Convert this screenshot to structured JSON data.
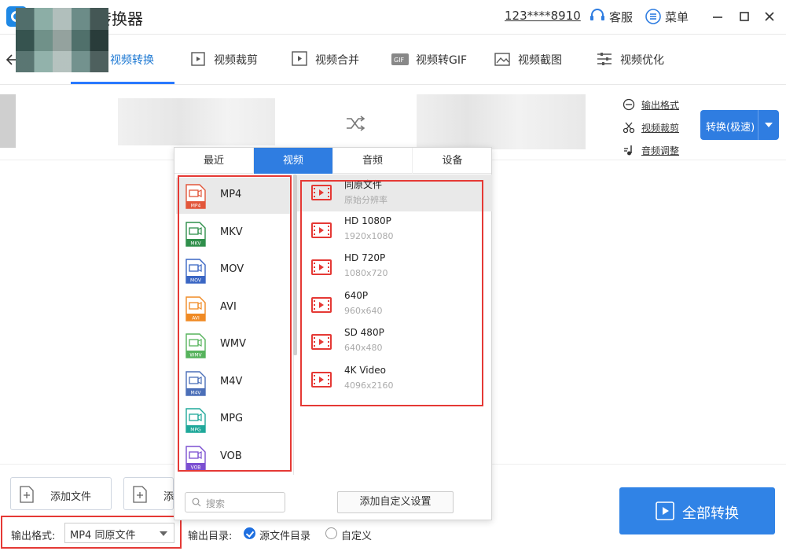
{
  "app": {
    "title": "风云视频转换器"
  },
  "account": {
    "phone": "123****8910",
    "service_label": "客服",
    "menu_label": "菜单"
  },
  "nav": {
    "back_label": "返回",
    "tabs": [
      {
        "label": "视频转换",
        "active": true
      },
      {
        "label": "视频裁剪"
      },
      {
        "label": "视频合并"
      },
      {
        "label": "视频转GIF"
      },
      {
        "label": "视频截图"
      },
      {
        "label": "视频优化"
      }
    ]
  },
  "file_options": {
    "output_format": "输出格式",
    "video_crop": "视频裁剪",
    "audio_adjust": "音频调整"
  },
  "convert_button": {
    "label": "转换(极速)"
  },
  "format_panel": {
    "tabs": [
      "最近",
      "视频",
      "音频",
      "设备"
    ],
    "active_tab": "视频",
    "formats": [
      {
        "name": "MP4",
        "badge": "MP4",
        "color": "#e2563a",
        "selected": true
      },
      {
        "name": "MKV",
        "badge": "MKV",
        "color": "#2f8f4b"
      },
      {
        "name": "MOV",
        "badge": "MOV",
        "color": "#3a66c4"
      },
      {
        "name": "AVI",
        "badge": "AVI",
        "color": "#f08a24"
      },
      {
        "name": "WMV",
        "badge": "WMV",
        "color": "#56b35c"
      },
      {
        "name": "M4V",
        "badge": "M4V",
        "color": "#4b6fb8"
      },
      {
        "name": "MPG",
        "badge": "MPG",
        "color": "#1fa89a"
      },
      {
        "name": "VOB",
        "badge": "VOB",
        "color": "#7b4fd1"
      }
    ],
    "resolutions": [
      {
        "name": "同原文件",
        "sub": "原始分辨率",
        "selected": true
      },
      {
        "name": "HD 1080P",
        "sub": "1920x1080"
      },
      {
        "name": "HD 720P",
        "sub": "1080x720"
      },
      {
        "name": "640P",
        "sub": "960x640"
      },
      {
        "name": "SD 480P",
        "sub": "640x480"
      },
      {
        "name": "4K Video",
        "sub": "4096x2160"
      }
    ],
    "search_placeholder": "搜索",
    "custom_button": "添加自定义设置"
  },
  "bottom": {
    "add_file": "添加文件",
    "add_folder": "添",
    "output_format_label": "输出格式:",
    "output_format_value": "MP4 同原文件",
    "output_dir_label": "输出目录:",
    "dir_options": [
      {
        "label": "源文件目录",
        "checked": true
      },
      {
        "label": "自定义",
        "checked": false
      }
    ],
    "convert_all": "全部转换"
  },
  "colors": {
    "accent": "#2f7de1",
    "highlight_border": "#e53935",
    "video_icon": "#e53935"
  }
}
